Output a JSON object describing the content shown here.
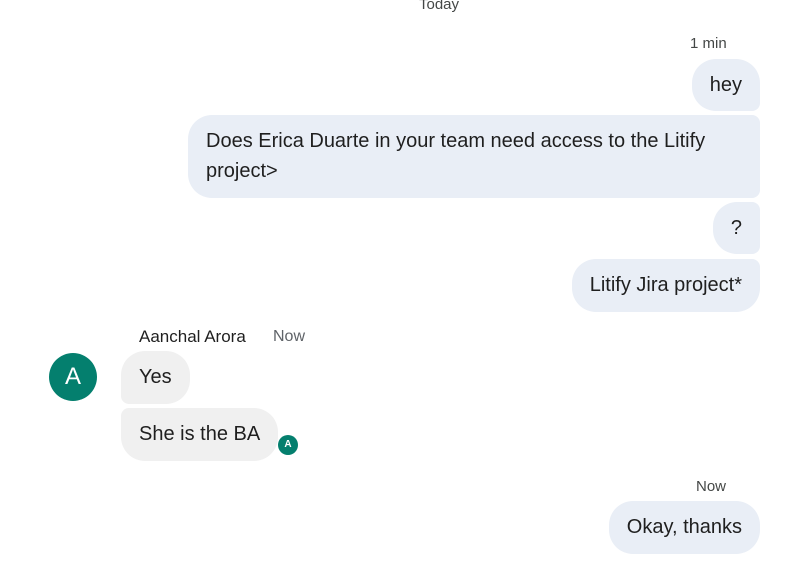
{
  "date_divider": "Today",
  "outgoing_group_1": {
    "time": "1 min",
    "messages": [
      "hey",
      "Does Erica Duarte in your team need access to the Litify",
      "project>",
      "?",
      "Litify Jira project*"
    ]
  },
  "incoming_group": {
    "avatar_letter": "A",
    "sender_name": "Aanchal Arora",
    "time": "Now",
    "messages": [
      "Yes",
      "She is the BA"
    ],
    "read_receipt_letter": "A"
  },
  "outgoing_group_2": {
    "time": "Now",
    "messages": [
      "Okay, thanks"
    ]
  },
  "colors": {
    "outgoing_bubble": "#e9eef6",
    "incoming_bubble": "#f0f0f0",
    "avatar": "#047f6e"
  }
}
